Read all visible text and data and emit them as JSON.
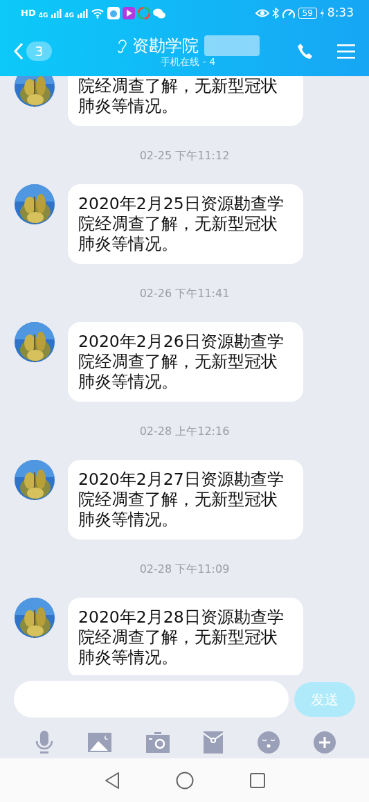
{
  "status_bar": {
    "left_labels": [
      "HD",
      "4G",
      "4G"
    ],
    "battery": "59",
    "time": "8:33"
  },
  "header": {
    "unread_count": "3",
    "title": "资勘学院",
    "subtitle": "手机在线 - 4"
  },
  "messages": [
    {
      "kind": "message",
      "text": "院经凋查了解，无新型冠状肺炎等情况。"
    },
    {
      "kind": "time",
      "text": "02-25 下午11:12"
    },
    {
      "kind": "message",
      "text": "2020年2月25日资源勘查学院经凋查了解，无新型冠状肺炎等情况。"
    },
    {
      "kind": "time",
      "text": "02-26 下午11:41"
    },
    {
      "kind": "message",
      "text": "2020年2月26日资源勘查学院经凋查了解，无新型冠状肺炎等情况。"
    },
    {
      "kind": "time",
      "text": "02-28 上午12:16"
    },
    {
      "kind": "message",
      "text": "2020年2月27日资源勘查学院经凋查了解，无新型冠状肺炎等情况。"
    },
    {
      "kind": "time",
      "text": "02-28 下午11:09"
    },
    {
      "kind": "message",
      "text": "2020年2月28日资源勘查学院经凋查了解，无新型冠状肺炎等情况。"
    }
  ],
  "composer": {
    "send_label": "发送",
    "send_disabled": true
  }
}
